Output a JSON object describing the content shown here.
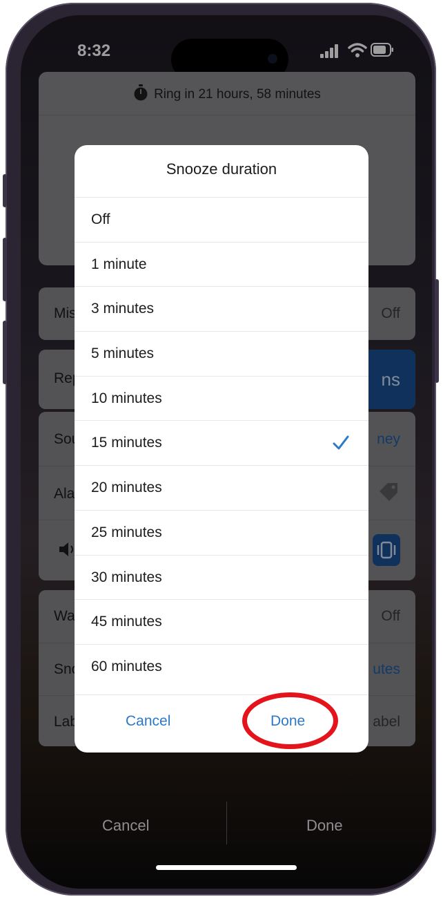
{
  "status_bar": {
    "time": "8:32"
  },
  "background": {
    "ring_text": "Ring in 21 hours, 58 minutes",
    "rows": [
      {
        "label": "Mis",
        "value": "Off"
      },
      {
        "label": "Rep",
        "value": "ns"
      },
      {
        "label": "Sou",
        "value": "ney"
      },
      {
        "label": "Alar",
        "value": ""
      },
      {
        "label": "",
        "value": ""
      },
      {
        "label": "Wal",
        "value": "Off"
      },
      {
        "label": "Sno",
        "value": "utes"
      },
      {
        "label": "Lab",
        "value": "abel"
      }
    ],
    "cancel_label": "Cancel",
    "done_label": "Done"
  },
  "dialog": {
    "title": "Snooze duration",
    "options": [
      "Off",
      "1 minute",
      "3 minutes",
      "5 minutes",
      "10 minutes",
      "15 minutes",
      "20 minutes",
      "25 minutes",
      "30 minutes",
      "45 minutes",
      "60 minutes"
    ],
    "selected": "15 minutes",
    "cancel_label": "Cancel",
    "done_label": "Done"
  },
  "colors": {
    "accent": "#2b79c7",
    "highlight": "#e3141b"
  }
}
